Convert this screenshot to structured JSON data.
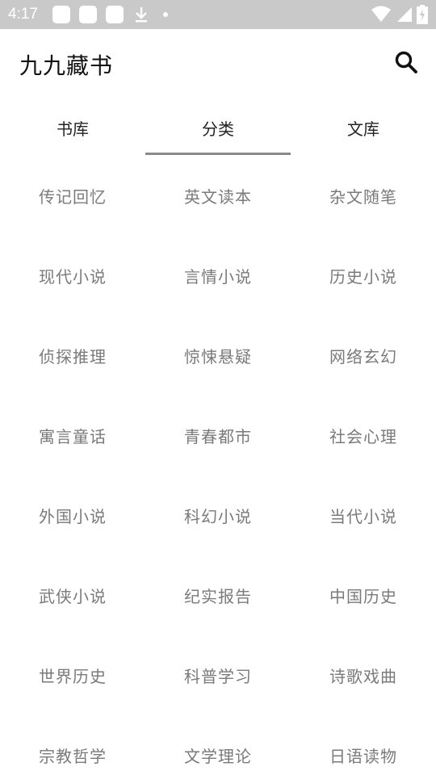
{
  "status_bar": {
    "time": "4:17",
    "icons": [
      "notification-icon",
      "notification-icon",
      "notification-icon",
      "download-icon",
      "dot-icon",
      "wifi-icon",
      "signal-icon",
      "battery-icon"
    ]
  },
  "app_bar": {
    "title": "九九藏书",
    "search_icon": "search-icon"
  },
  "tabs": [
    {
      "label": "书库",
      "active": false
    },
    {
      "label": "分类",
      "active": true
    },
    {
      "label": "文库",
      "active": false
    }
  ],
  "categories": [
    [
      "传记回忆",
      "英文读本",
      "杂文随笔"
    ],
    [
      "现代小说",
      "言情小说",
      "历史小说"
    ],
    [
      "侦探推理",
      "惊悚悬疑",
      "网络玄幻"
    ],
    [
      "寓言童话",
      "青春都市",
      "社会心理"
    ],
    [
      "外国小说",
      "科幻小说",
      "当代小说"
    ],
    [
      "武侠小说",
      "纪实报告",
      "中国历史"
    ],
    [
      "世界历史",
      "科普学习",
      "诗歌戏曲"
    ],
    [
      "宗教哲学",
      "文学理论",
      "日语读物"
    ]
  ],
  "colors": {
    "status_bar_bg": "#c9c9c9",
    "tab_indicator": "#8a8a8a",
    "category_text": "#7a7a7a"
  }
}
